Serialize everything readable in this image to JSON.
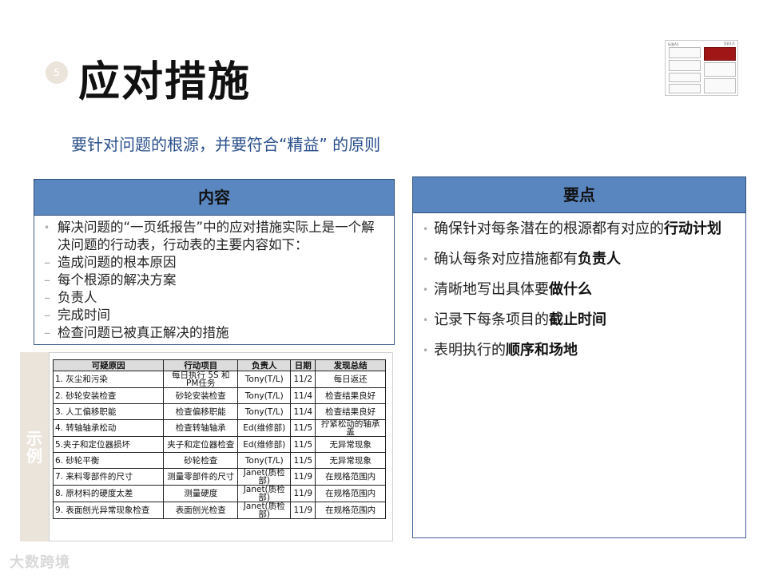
{
  "slide": {
    "number": "5",
    "title": "应对措施",
    "subtitle": "要针对问题的根源，并要符合“精益” 的原则"
  },
  "left_panel": {
    "header": "内容",
    "intro": "解决问题的“一页纸报告”中的应对措施实际上是一个解决问题的行动表，行动表的主要内容如下：",
    "items": [
      "造成问题的根本原因",
      "每个根源的解决方案",
      "负责人",
      "完成时间",
      "检查问题已被真正解决的措施"
    ]
  },
  "right_panel": {
    "header": "要点",
    "points": [
      {
        "text": "确保针对每条潜在的根源都有对应的",
        "bold": "行动计划"
      },
      {
        "text": "确认每条对应措施都有",
        "bold": "负责人"
      },
      {
        "text": "清晰地写出具体要",
        "bold": "做什么"
      },
      {
        "text": "记录下每条项目的",
        "bold": "截止时间"
      },
      {
        "text": "表明执行的",
        "bold": "顺序和场地"
      }
    ]
  },
  "example": {
    "side_label_1": "示",
    "side_label_2": "例",
    "columns": [
      "可疑原因",
      "行动项目",
      "负责人",
      "日期",
      "发现总结"
    ],
    "rows": [
      [
        "1. 灰尘和污染",
        "每日执行 5S 和PM任务",
        "Tony(T/L)",
        "11/2",
        "每日返还"
      ],
      [
        "2. 砂轮安装检查",
        "砂轮安装检查",
        "Tony(T/L)",
        "11/4",
        "检查结果良好"
      ],
      [
        "3. 人工偏移职能",
        "检查偏移职能",
        "Tony(T/L)",
        "11/4",
        "检查结果良好"
      ],
      [
        "4. 转轴轴承松动",
        "检查转轴轴承",
        "Ed(维修部)",
        "11/5",
        "拧紧松动的轴承盖"
      ],
      [
        "5.夹子和定位器损坏",
        "夹子和定位器检查",
        "Ed(维修部)",
        "11/5",
        "无异常现象"
      ],
      [
        "6. 砂轮平衡",
        "砂轮检查",
        "Tony(T/L)",
        "11/5",
        "无异常现象"
      ],
      [
        "7. 来料零部件的尺寸",
        "测量零部件的尺寸",
        "Janet(质检部)",
        "11/9",
        "在规格范围内"
      ],
      [
        "8. 原材料的硬度太差",
        "测量硬度",
        "Janet(质检部)",
        "11/9",
        "在规格范围内"
      ],
      [
        "9. 表面刨光异常现象检查",
        "表面刨光检查",
        "Janet(质检部)",
        "11/9",
        "在规格范围内"
      ]
    ]
  },
  "thumbnail": {
    "title": "标准A3",
    "page": "页码1/1"
  },
  "watermark": "大数跨境"
}
